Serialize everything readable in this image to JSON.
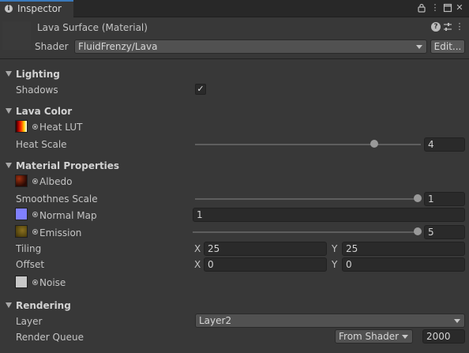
{
  "tab": {
    "label": "Inspector"
  },
  "header": {
    "material_name": "Lava Surface (Material)",
    "shader_label": "Shader",
    "shader_value": "FluidFrenzy/Lava",
    "edit_label": "Edit..."
  },
  "sections": {
    "lighting": "Lighting",
    "lava_color": "Lava Color",
    "material_properties": "Material Properties",
    "rendering": "Rendering"
  },
  "lighting": {
    "shadows_label": "Shadows",
    "shadows_checked": true,
    "check_glyph": "✓"
  },
  "lava_color": {
    "heat_lut_label": "Heat LUT",
    "heat_scale_label": "Heat Scale",
    "heat_scale_value": "4",
    "heat_scale_level": 0.92
  },
  "material": {
    "albedo_label": "Albedo",
    "smoothness_label": "Smoothnes Scale",
    "smoothness_value": "1",
    "smoothness_level": 1.0,
    "normal_map_label": "Normal Map",
    "normal_map_value": "1",
    "emission_label": "Emission",
    "emission_value": "5",
    "emission_level": 1.0,
    "tiling_label": "Tiling",
    "tiling_x_label": "X",
    "tiling_x": "25",
    "tiling_y_label": "Y",
    "tiling_y": "25",
    "offset_label": "Offset",
    "offset_x_label": "X",
    "offset_x": "0",
    "offset_y_label": "Y",
    "offset_y": "0",
    "noise_label": "Noise"
  },
  "rendering": {
    "layer_label": "Layer",
    "layer_value": "Layer2",
    "queue_label": "Render Queue",
    "queue_mode": "From Shader",
    "queue_value": "2000"
  },
  "colors": {
    "tab_accent": "#3a79bb",
    "normal_map_swatch": "#8080ff",
    "noise_swatch": "#c8c8c8"
  },
  "icons": [
    "info-icon",
    "lock-icon",
    "menu-icon",
    "maximize-icon",
    "close-icon",
    "help-icon",
    "preset-icon",
    "more-icon",
    "foldout-arrow-icon",
    "object-picker-icon",
    "dropdown-arrow-icon",
    "check-icon"
  ]
}
